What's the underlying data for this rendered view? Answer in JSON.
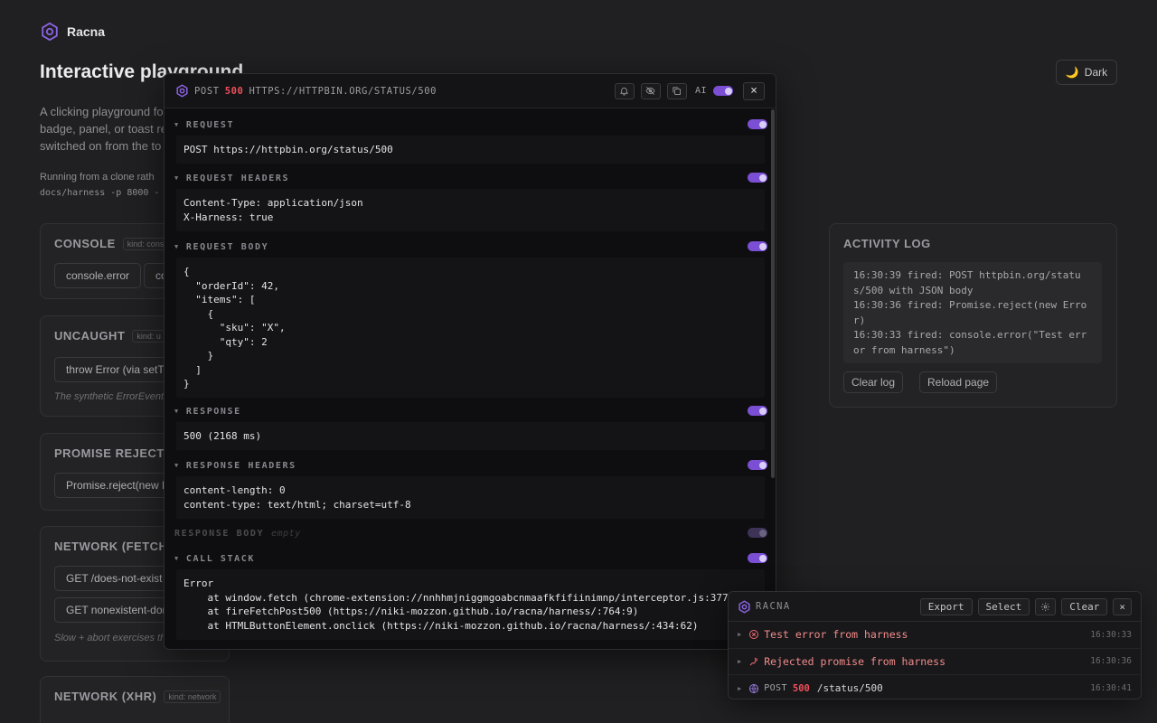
{
  "app": {
    "brand": "Racna",
    "page_title": "Interactive playground",
    "theme_label": "Dark"
  },
  "intro": {
    "paragraph": "A clicking playground fo... badge, panel, or toast re... switched on from the to...",
    "line1": "A clicking playground fo",
    "line2": "badge, panel, or toast re",
    "line3": "switched on from the to",
    "run1": "Running from a clone rath",
    "run2": "docs/harness -p 8000 -"
  },
  "cards": [
    {
      "title": "CONSOLE",
      "kind": "kind: cons",
      "buttons": [
        "console.error",
        "co"
      ]
    },
    {
      "title": "UNCAUGHT",
      "kind": "kind: u",
      "buttons": [
        "throw Error (via setT"
      ],
      "note": "The synthetic ErrorEvent i"
    },
    {
      "title": "PROMISE REJECTIO",
      "buttons": [
        "Promise.reject(new E"
      ]
    },
    {
      "title": "NETWORK (FETCH",
      "buttons": [
        "GET /does-not-exist",
        "GET nonexistent-dor"
      ],
      "note": "Slow + abort exercises th"
    },
    {
      "title": "NETWORK (XHR)",
      "kind": "kind: network"
    }
  ],
  "activity": {
    "title": "ACTIVITY LOG",
    "entries": [
      "16:30:39  fired: POST httpbin.org/status/500 with JSON body",
      "16:30:36  fired: Promise.reject(new Error)",
      "16:30:33  fired: console.error(\"Test error from harness\")"
    ],
    "clear_label": "Clear log",
    "reload_label": "Reload page"
  },
  "modal": {
    "method": "POST",
    "status": "500",
    "url": "HTTPS://HTTPBIN.ORG/STATUS/500",
    "ai_label": "AI",
    "close": "×",
    "sections": {
      "request": {
        "label": "REQUEST",
        "body": "POST https://httpbin.org/status/500"
      },
      "request_headers": {
        "label": "REQUEST HEADERS",
        "body": "Content-Type: application/json\nX-Harness: true"
      },
      "request_body": {
        "label": "REQUEST BODY",
        "body": "{\n  \"orderId\": 42,\n  \"items\": [\n    {\n      \"sku\": \"X\",\n      \"qty\": 2\n    }\n  ]\n}"
      },
      "response": {
        "label": "RESPONSE",
        "body": "500 (2168 ms)"
      },
      "response_headers": {
        "label": "RESPONSE HEADERS",
        "body": "content-length: 0\ncontent-type: text/html; charset=utf-8"
      },
      "response_body": {
        "label": "RESPONSE BODY",
        "empty": "empty"
      },
      "call_stack": {
        "label": "CALL STACK",
        "body": "Error\n    at window.fetch (chrome-extension://nnhhmjniggmgoabcnmaafkfifiinimnp/interceptor.js:377:25)\n    at fireFetchPost500 (https://niki-mozzon.github.io/racna/harness/:764:9)\n    at HTMLButtonElement.onclick (https://niki-mozzon.github.io/racna/harness/:434:62)"
      }
    }
  },
  "panel": {
    "name": "RACNA",
    "export": "Export",
    "select": "Select",
    "clear": "Clear",
    "close": "×",
    "rows": [
      {
        "message": "Test error from harness",
        "time": "16:30:33",
        "icon": "error-circle-icon"
      },
      {
        "message": "Rejected promise from harness",
        "time": "16:30:36",
        "icon": "broken-promise-icon"
      },
      {
        "method": "POST",
        "status": "500",
        "path": "/status/500",
        "time": "16:30:41",
        "icon": "globe-icon"
      }
    ]
  },
  "colors": {
    "accent": "#7a4fd4",
    "error": "#ef4f5a",
    "error_text": "#f28b8b"
  }
}
